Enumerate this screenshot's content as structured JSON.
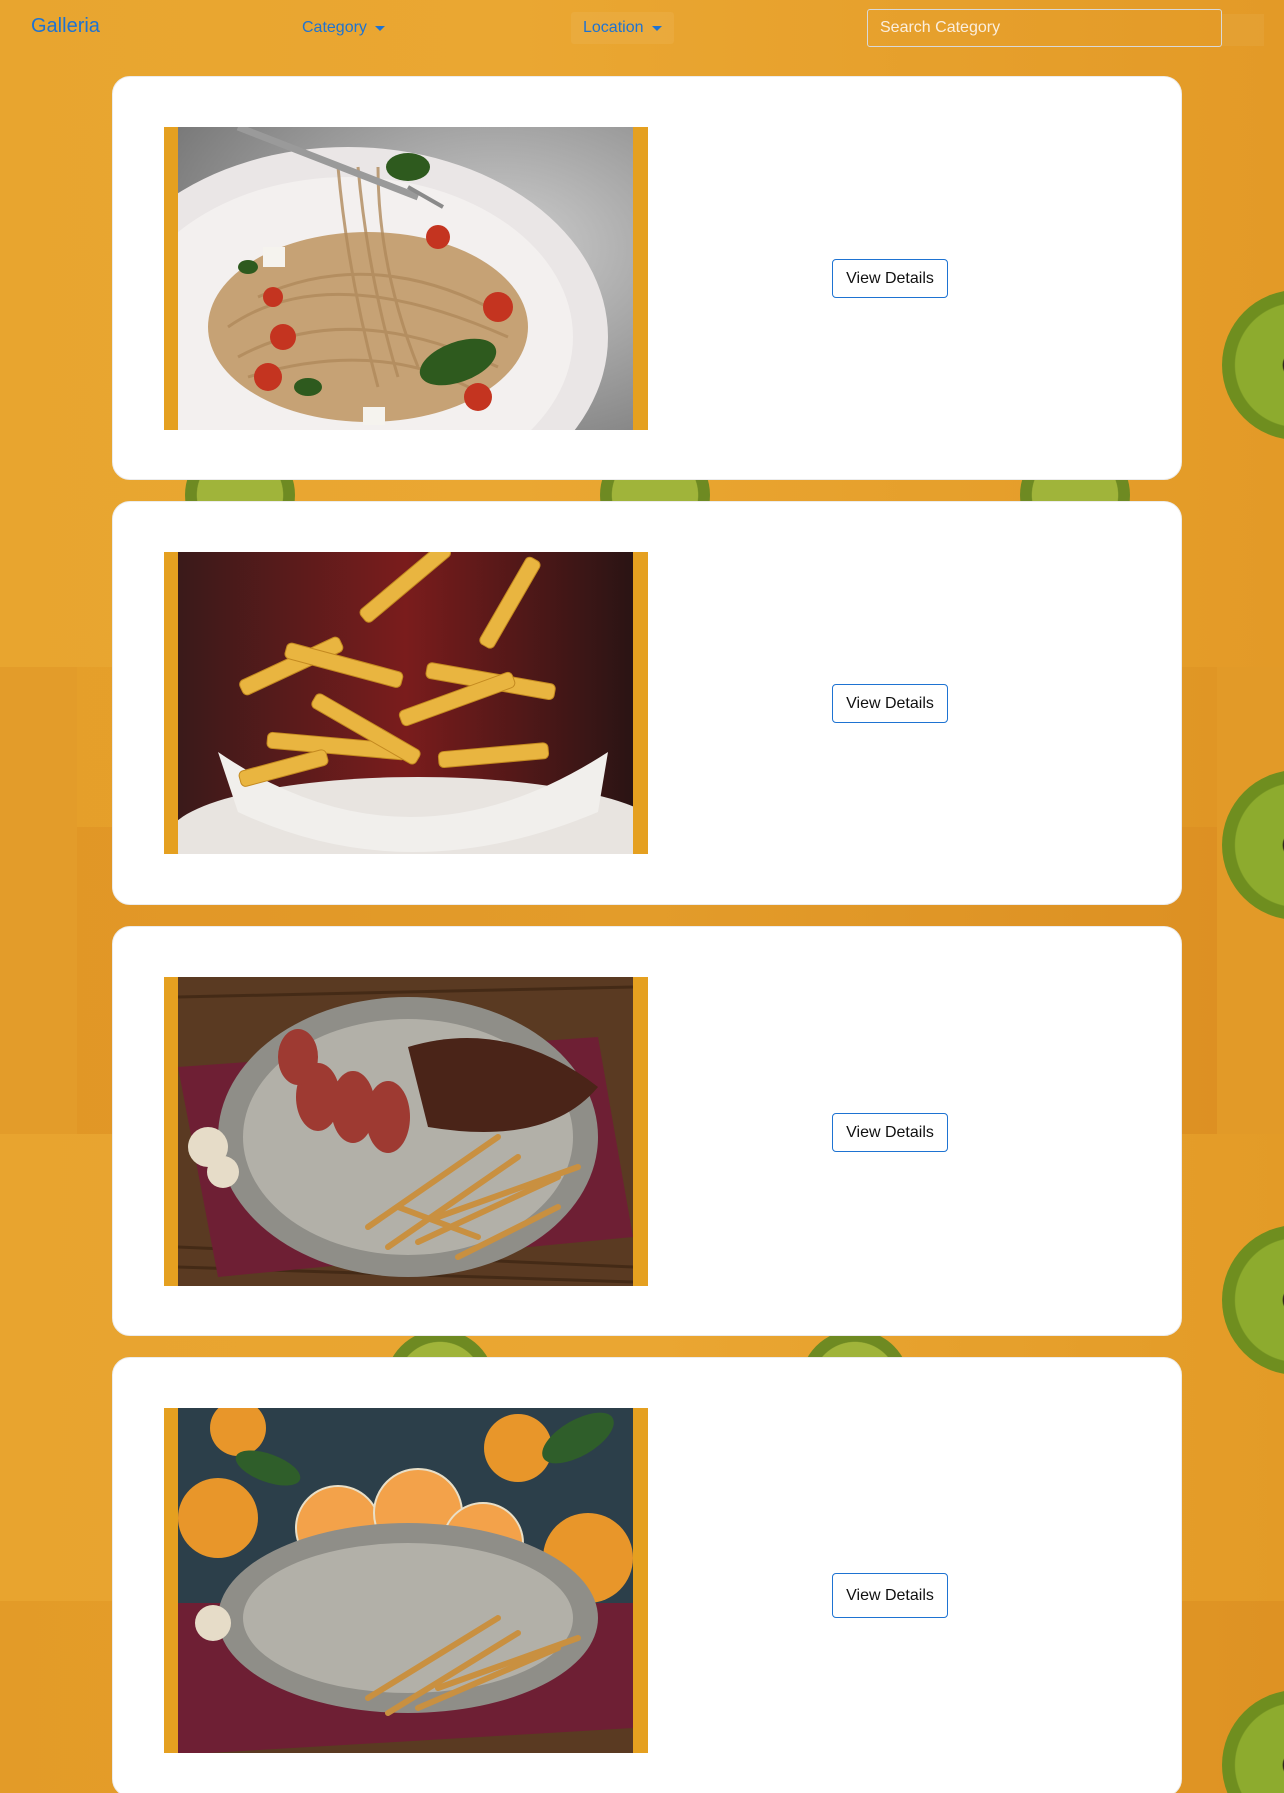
{
  "navbar": {
    "brand": "Galleria",
    "category_label": "Category",
    "location_label": "Location",
    "search_placeholder": "Search Category"
  },
  "cards": [
    {
      "image_icon": "pasta-photo",
      "button_label": "View Details"
    },
    {
      "image_icon": "fries-photo",
      "button_label": "View Details"
    },
    {
      "image_icon": "steak-photo",
      "button_label": "View Details"
    },
    {
      "image_icon": "mandarin-photo",
      "button_label": "View Details"
    }
  ],
  "colors": {
    "accent": "#1e73d2",
    "background": "#e8a32c",
    "frame": "#e5a020",
    "card": "#ffffff"
  }
}
